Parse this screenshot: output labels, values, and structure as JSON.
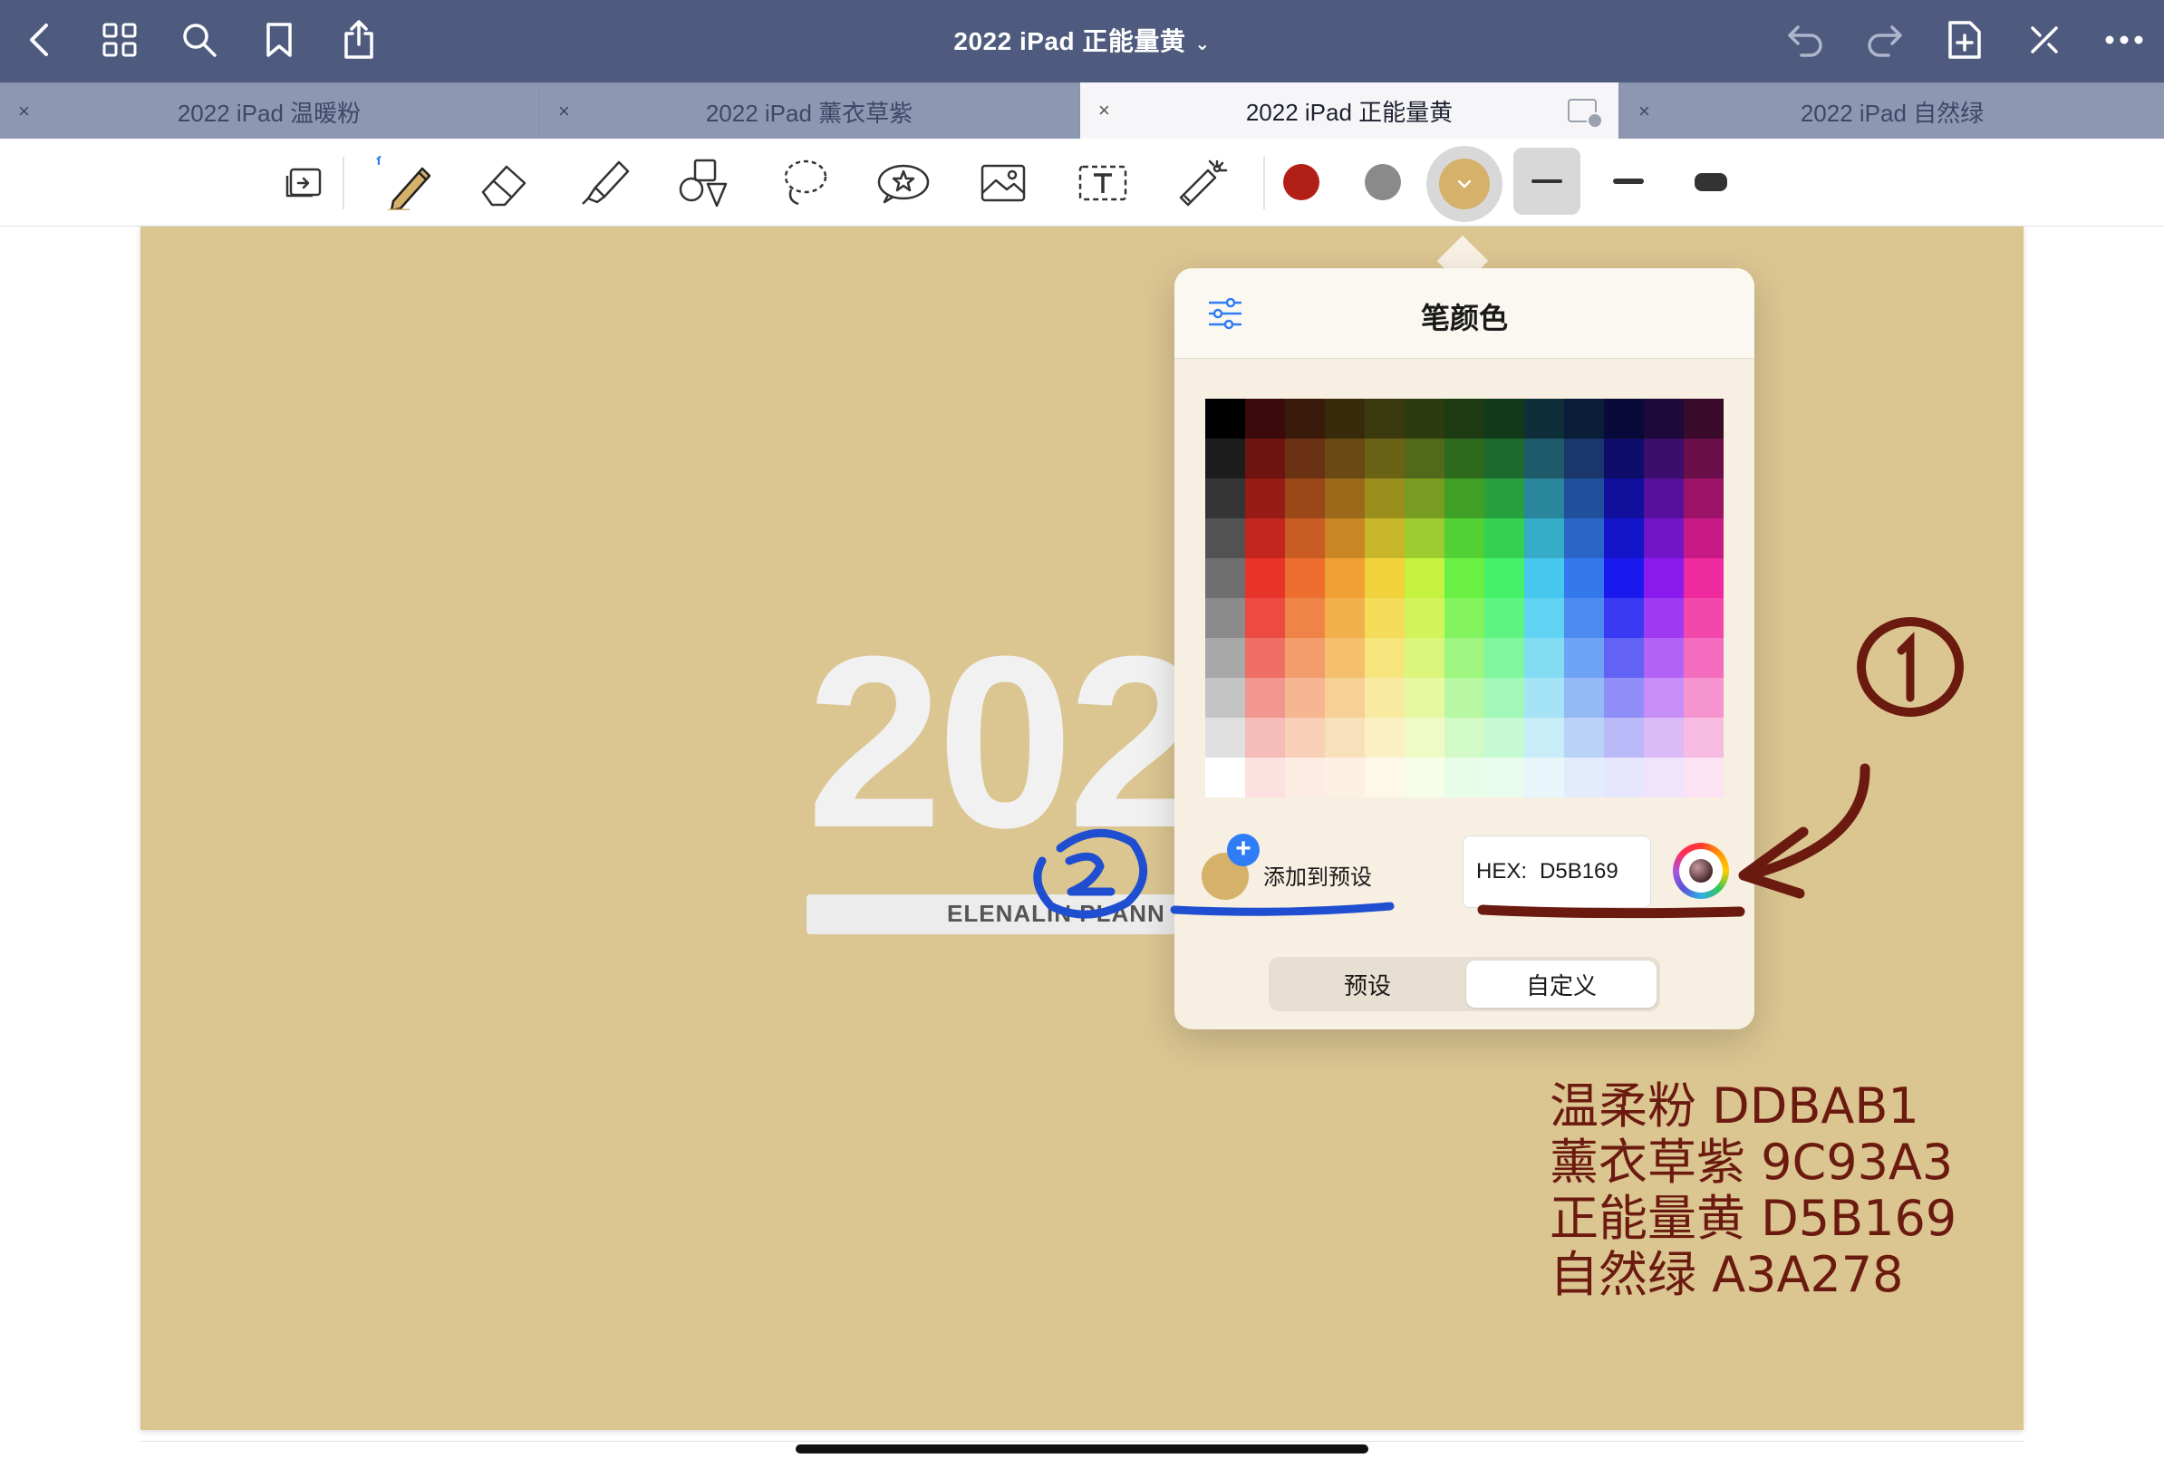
{
  "topbar": {
    "title": "2022 iPad 正能量黄",
    "title_caret": "⌄"
  },
  "tabs": [
    {
      "label": "2022 iPad 温暖粉",
      "close": "×",
      "active": false
    },
    {
      "label": "2022 iPad 薰衣草紫",
      "close": "×",
      "active": false
    },
    {
      "label": "2022 iPad 正能量黄",
      "close": "×",
      "active": true
    },
    {
      "label": "2022 iPad 自然绿",
      "close": "×",
      "active": false
    }
  ],
  "toolbar": {
    "tools": [
      "page-view-icon",
      "pen-icon",
      "eraser-icon",
      "highlighter-icon",
      "shapes-icon",
      "lasso-icon",
      "sticker-icon",
      "image-icon",
      "text-icon",
      "laser-pointer-icon"
    ],
    "colors": [
      "#b21f17",
      "#8a8a8a",
      "#d5b169"
    ],
    "selected_color": "#d5b169",
    "stroke_sizes": [
      "thin",
      "medium",
      "thick"
    ]
  },
  "page": {
    "year": "2022",
    "brand": "ELENALIN PLANN"
  },
  "color_popover": {
    "title": "笔颜色",
    "add_to_preset": "添加到预设",
    "add_plus": "+",
    "hex_label": "HEX:",
    "hex_value": "D5B169",
    "segments": [
      "预设",
      "自定义"
    ],
    "selected_segment": "自定义"
  },
  "palette_rows": [
    [
      "#000000",
      "#3b0a0a",
      "#3a1a0a",
      "#3a2a0c",
      "#3a3a0e",
      "#2e3a10",
      "#1e3a12",
      "#123a18",
      "#0e2e3a",
      "#0a1e3a",
      "#0a0a3a",
      "#1e0a3a",
      "#3a0a2a"
    ],
    [
      "#1c1c1c",
      "#6e1410",
      "#6a3212",
      "#6a4a14",
      "#6a6214",
      "#52681a",
      "#2e6a1e",
      "#1e6a2e",
      "#1e5a6a",
      "#1a366a",
      "#0e0e6a",
      "#3a0e6a",
      "#6a0e4a"
    ],
    [
      "#353535",
      "#961c16",
      "#9a4818",
      "#9a6a1a",
      "#9a8e1c",
      "#789c22",
      "#40a026",
      "#28a03e",
      "#2a869c",
      "#20509c",
      "#10109c",
      "#56109c",
      "#9c1468"
    ],
    [
      "#525252",
      "#c2261e",
      "#c85c22",
      "#c88624",
      "#c8b62a",
      "#9ccc30",
      "#52d034",
      "#34d052",
      "#36acc8",
      "#2a66c8",
      "#1414c8",
      "#7214c8",
      "#c81a86"
    ],
    [
      "#6f6f6f",
      "#e8332a",
      "#ee6e30",
      "#f0a034",
      "#f2d23c",
      "#c4f23e",
      "#6af044",
      "#44f068",
      "#46c8ee",
      "#3478ee",
      "#1a1aee",
      "#8a1aee",
      "#ee2a9e"
    ],
    [
      "#8b8b8b",
      "#ec4a42",
      "#f08448",
      "#f2b04c",
      "#f4dc58",
      "#d2f45a",
      "#84f45e",
      "#5ef482",
      "#60d2f2",
      "#4c8cf2",
      "#3a3af2",
      "#9e3af2",
      "#f248ac"
    ],
    [
      "#a8a8a8",
      "#ef6e66",
      "#f39c6c",
      "#f4c06e",
      "#f6e47c",
      "#dcf67c",
      "#9ef680",
      "#80f69e",
      "#82dcf4",
      "#6ea2f4",
      "#6262f4",
      "#b262f4",
      "#f46cbe"
    ],
    [
      "#c4c4c4",
      "#f29690",
      "#f6b692",
      "#f6d094",
      "#f8eaa0",
      "#e6f8a0",
      "#b8f8a2",
      "#a2f8b8",
      "#a4e4f6",
      "#94baf6",
      "#8e8ef6",
      "#c68ef6",
      "#f694d0"
    ],
    [
      "#e0e0e0",
      "#f6bcb8",
      "#f8d0b8",
      "#f8e0ba",
      "#faf0c4",
      "#f0fac4",
      "#d2fac6",
      "#c6fad2",
      "#c8ecf8",
      "#bad2f8",
      "#babaf8",
      "#dcbaf8",
      "#f8bce2"
    ],
    [
      "#ffffff",
      "#fbe2e0",
      "#fcece2",
      "#fcf0e2",
      "#fdf8e8",
      "#f8fde8",
      "#e8fde8",
      "#e8fdee",
      "#e8f6fc",
      "#e2ecfc",
      "#e6e6fc",
      "#efe4fc",
      "#fce2f2"
    ]
  ],
  "annotations": {
    "circled_one": "1",
    "circled_two": "2",
    "notes": [
      "温柔粉 DDBAB1",
      "薰衣草紫 9C93A3",
      "正能量黄 D5B169",
      "自然绿 A3A278"
    ],
    "ink_red": "#6b1a10",
    "ink_blue": "#1f4fd0"
  }
}
